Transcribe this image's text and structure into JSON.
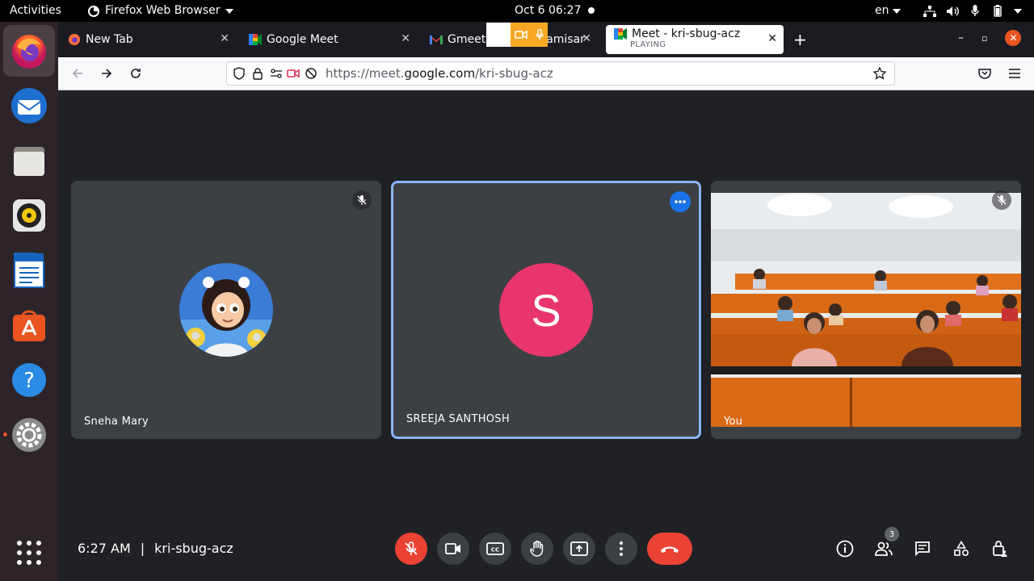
{
  "topbar": {
    "activities": "Activities",
    "app_name": "Firefox Web Browser",
    "clock": "Oct 6  06:27",
    "lang": "en"
  },
  "browser": {
    "tabs": [
      {
        "label": "New Tab",
        "favicon": "firefox-icon"
      },
      {
        "label": "Google Meet",
        "favicon": "google-meet-icon"
      },
      {
        "label": "Gmeet",
        "favicon": "gmail-icon"
      },
      {
        "label": "amisar",
        "favicon": "none"
      },
      {
        "label": "Meet - kri-sbug-acz",
        "sublabel": "PLAYING",
        "favicon": "google-meet-icon"
      }
    ],
    "url": {
      "scheme": "https://meet.",
      "host": "google.com",
      "path": "/kri-sbug-acz"
    }
  },
  "meet": {
    "participants": [
      {
        "name": "Sneha Mary",
        "muted": true,
        "avatar": "cartoon-girl-avatar"
      },
      {
        "name": "SREEJA SANTHOSH",
        "initial": "S",
        "avatar_color": "#e8356d",
        "active_speaker": true
      },
      {
        "name": "You",
        "muted": true,
        "video": "classroom-camera-feed"
      }
    ],
    "bottom": {
      "time": "6:27 AM",
      "separator": "|",
      "meeting_code": "kri-sbug-acz",
      "people_count": "3"
    }
  },
  "colors": {
    "accent": "#1a73e8",
    "danger": "#ea4335",
    "speaker_border": "#8ab4f8",
    "ubuntu_orange": "#e95420"
  }
}
